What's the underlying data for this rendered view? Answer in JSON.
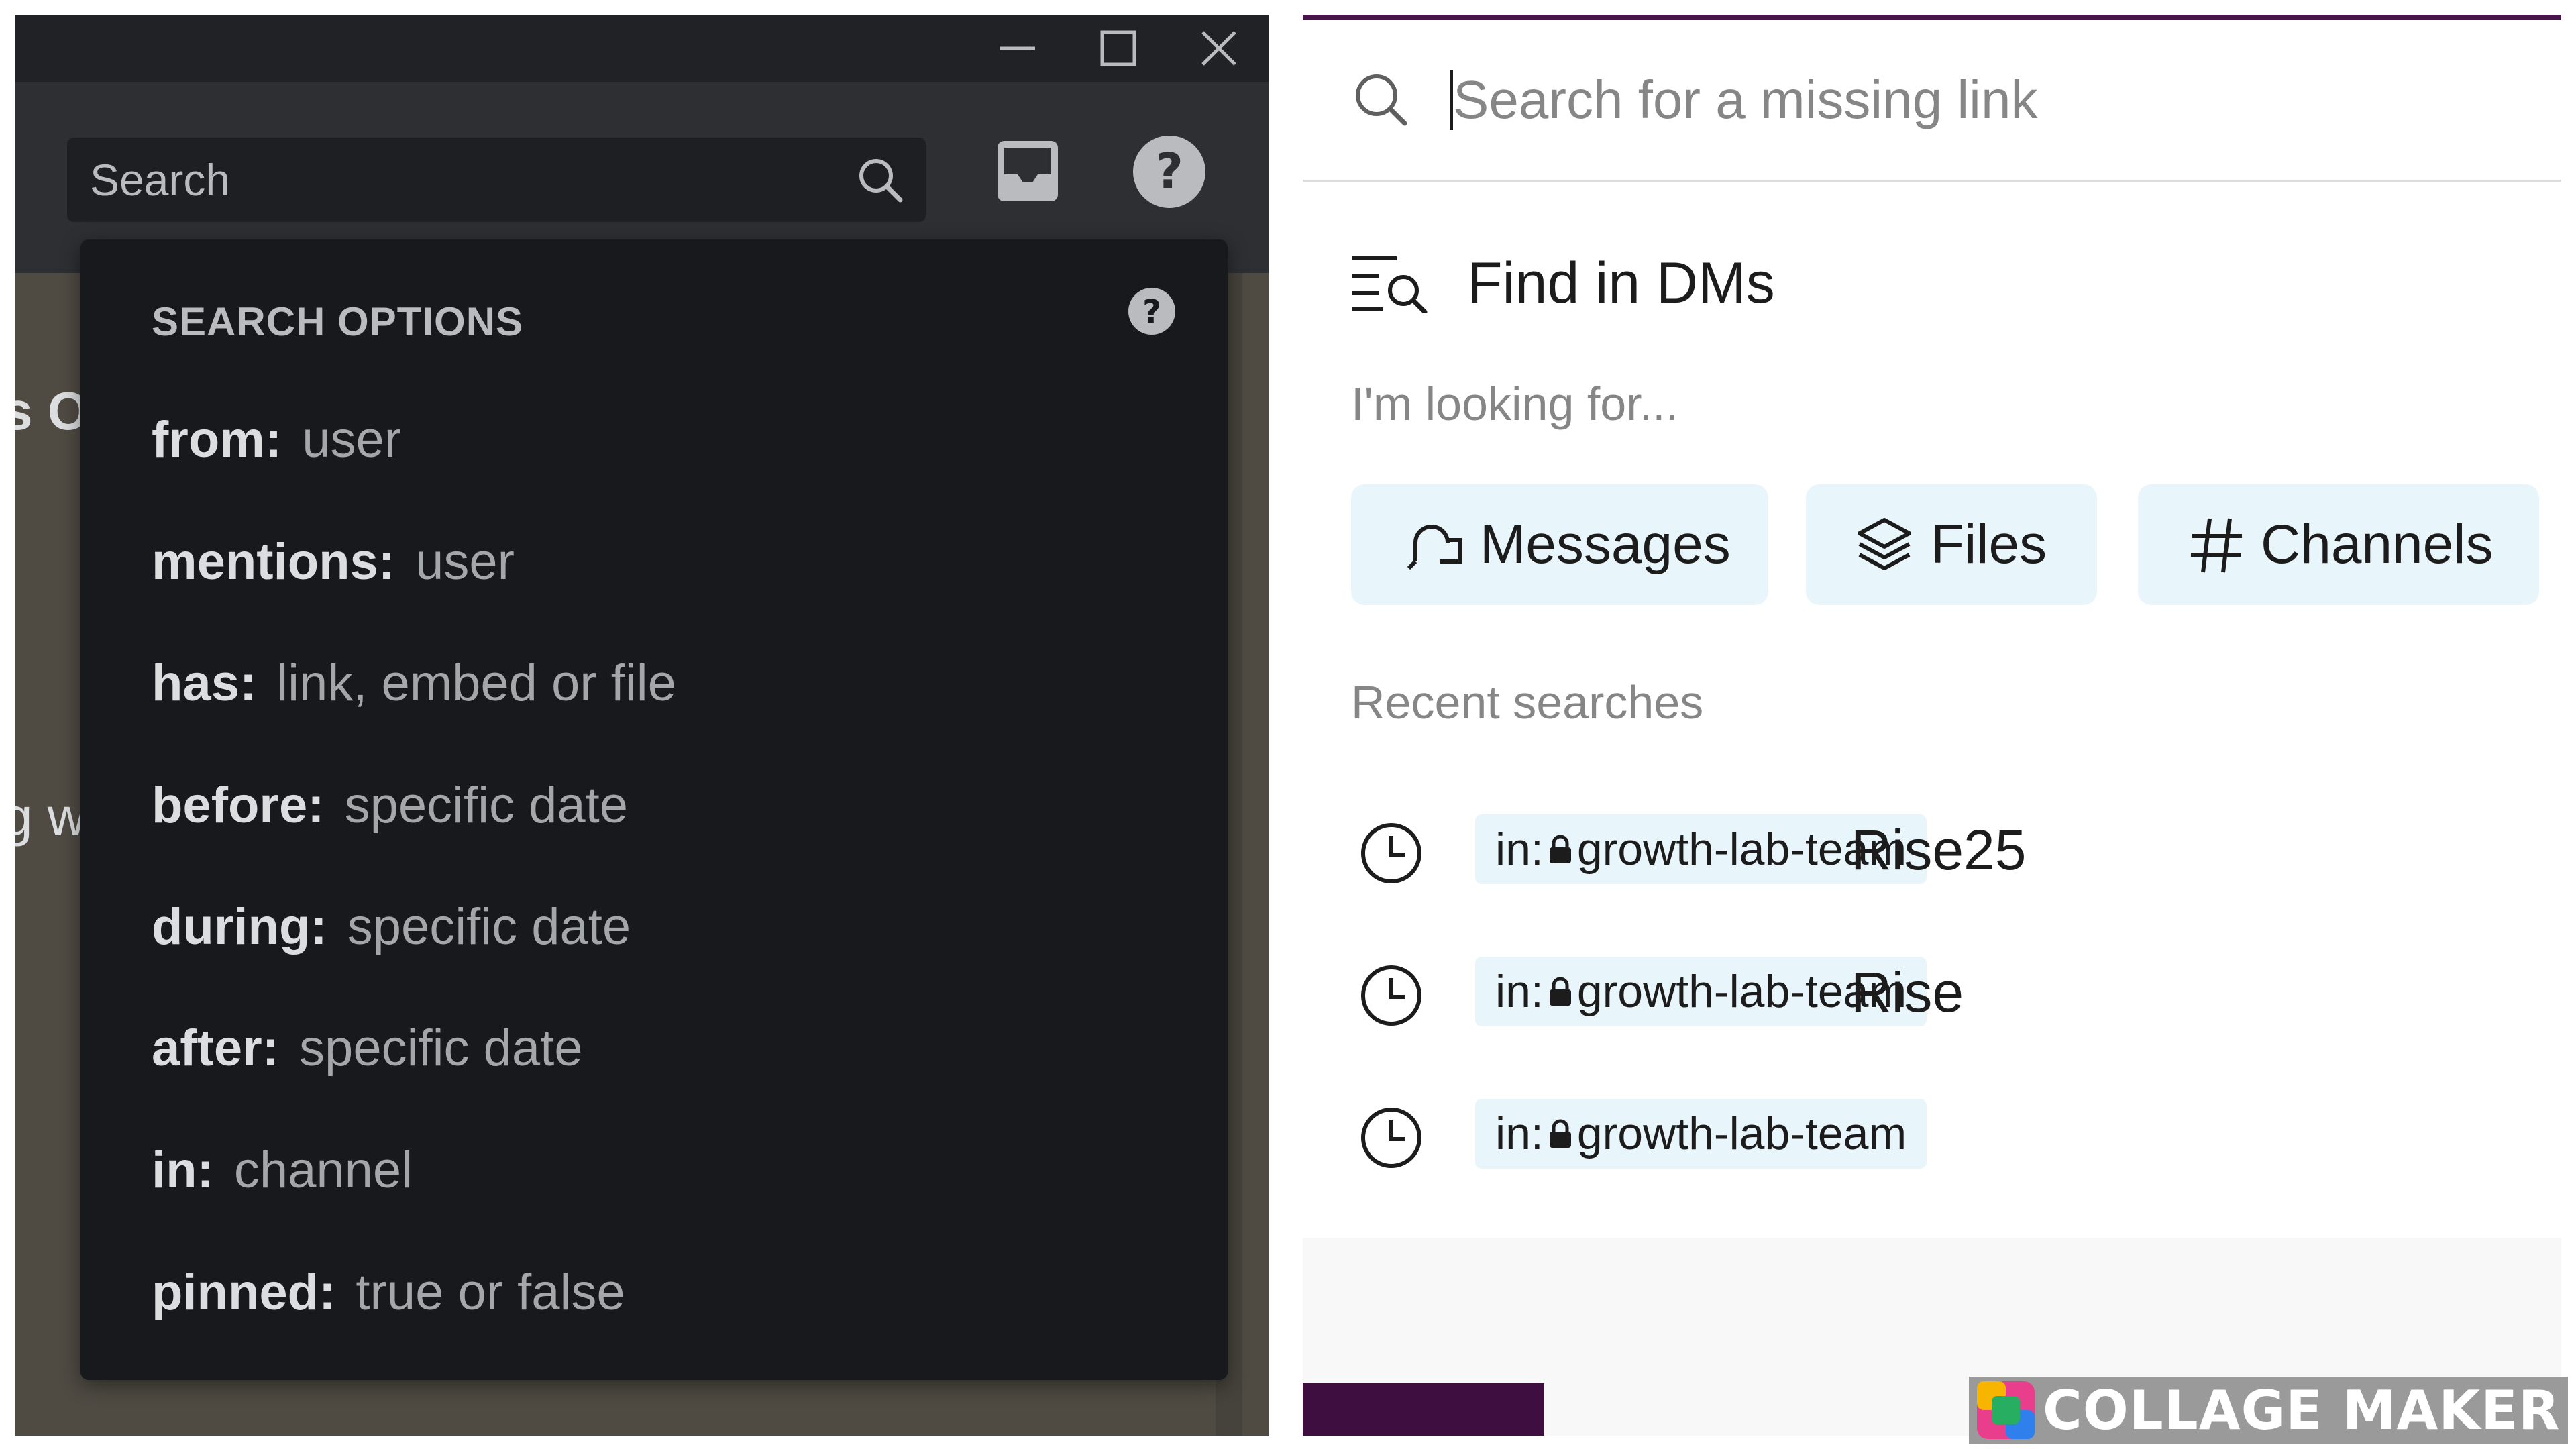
{
  "left": {
    "search": {
      "label": "Search"
    },
    "background_fragments": [
      "s O",
      "g w"
    ],
    "search_options": {
      "header": "SEARCH OPTIONS",
      "items": [
        {
          "key": "from:",
          "value": "user"
        },
        {
          "key": "mentions:",
          "value": "user"
        },
        {
          "key": "has:",
          "value": "link, embed or file"
        },
        {
          "key": "before:",
          "value": "specific date"
        },
        {
          "key": "during:",
          "value": "specific date"
        },
        {
          "key": "after:",
          "value": "specific date"
        },
        {
          "key": "in:",
          "value": "channel"
        },
        {
          "key": "pinned:",
          "value": "true or false"
        }
      ]
    },
    "icons": [
      "minimize-icon",
      "maximize-icon",
      "close-icon",
      "search-icon",
      "inbox-icon",
      "help-icon"
    ]
  },
  "right": {
    "search": {
      "placeholder": "Search for a missing link"
    },
    "find_title": "Find in DMs",
    "looking_label": "I'm looking for...",
    "chips": [
      {
        "label": "Messages",
        "icon": "messages-icon"
      },
      {
        "label": "Files",
        "icon": "files-layers-icon"
      },
      {
        "label": "Channels",
        "icon": "hash-icon"
      }
    ],
    "recent_label": "Recent searches",
    "recent": [
      {
        "tag_prefix": "in:",
        "tag_channel": "growth-lab-team",
        "query": "Rise25"
      },
      {
        "tag_prefix": "in:",
        "tag_channel": "growth-lab-team",
        "query": "Rise"
      },
      {
        "tag_prefix": "in:",
        "tag_channel": "growth-lab-team",
        "query": ""
      }
    ],
    "colors": {
      "accent": "#4a154b",
      "chip_bg": "#e8f5fa"
    }
  },
  "watermark": {
    "text": "COLLAGE MAKER"
  }
}
